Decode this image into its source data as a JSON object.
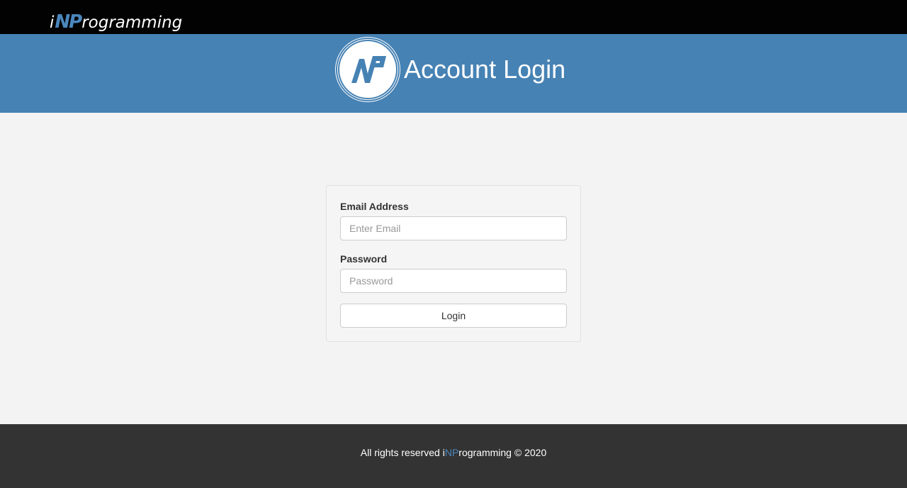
{
  "navbar": {
    "brand": {
      "prefix": "i",
      "highlight": "NP",
      "suffix": "rogramming"
    }
  },
  "header": {
    "logo_icon": "np-logo-icon",
    "title": "Account Login"
  },
  "login_form": {
    "email_label": "Email Address",
    "email_placeholder": "Enter Email",
    "email_value": "",
    "password_label": "Password",
    "password_placeholder": "Password",
    "password_value": "",
    "login_label": "Login"
  },
  "footer": {
    "text_before": "All rights reserved ",
    "brand_prefix": "i",
    "brand_highlight": "NP",
    "brand_suffix": "rogramming",
    "text_after": " © 2020"
  },
  "colors": {
    "topbar": "#020203",
    "header": "#4682b4",
    "page_background": "#f3f3f3",
    "footer": "#333333",
    "accent": "#4a87bd"
  }
}
